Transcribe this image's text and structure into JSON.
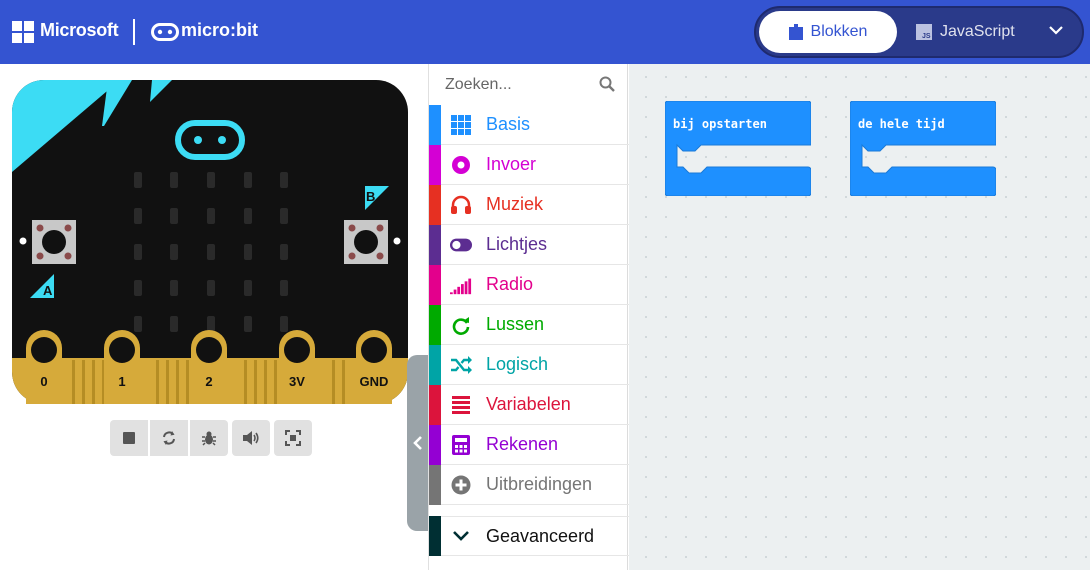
{
  "header": {
    "brand": "Microsoft",
    "product": "micro:bit",
    "modes": {
      "blocks": "Blokken",
      "javascript": "JavaScript",
      "js_badge": "JS"
    }
  },
  "simulator": {
    "buttons": {
      "a": "A",
      "b": "B"
    },
    "pins": [
      "0",
      "1",
      "2",
      "3V",
      "GND"
    ],
    "toolbar": [
      "stop-icon",
      "restart-icon",
      "debug-icon",
      "sound-icon",
      "fullscreen-icon"
    ]
  },
  "toolbox": {
    "search_placeholder": "Zoeken...",
    "categories": [
      {
        "label": "Basis",
        "color": "#1e90ff",
        "icon": "grid-icon"
      },
      {
        "label": "Invoer",
        "color": "#d400d4",
        "icon": "circle-icon"
      },
      {
        "label": "Muziek",
        "color": "#e63022",
        "icon": "headphones-icon"
      },
      {
        "label": "Lichtjes",
        "color": "#5c2d91",
        "icon": "toggle-icon"
      },
      {
        "label": "Radio",
        "color": "#e3008c",
        "icon": "signal-icon"
      },
      {
        "label": "Lussen",
        "color": "#00aa00",
        "icon": "refresh-icon"
      },
      {
        "label": "Logisch",
        "color": "#00a4a6",
        "icon": "shuffle-icon"
      },
      {
        "label": "Variabelen",
        "color": "#dc143c",
        "icon": "lines-icon"
      },
      {
        "label": "Rekenen",
        "color": "#9400d3",
        "icon": "calculator-icon"
      },
      {
        "label": "Uitbreidingen",
        "color": "#757575",
        "icon": "plus-circle-icon"
      }
    ],
    "advanced": {
      "label": "Geavanceerd",
      "color": "#002f33"
    }
  },
  "workspace": {
    "blocks": [
      {
        "label": "bij opstarten"
      },
      {
        "label": "de hele tijd"
      }
    ]
  }
}
